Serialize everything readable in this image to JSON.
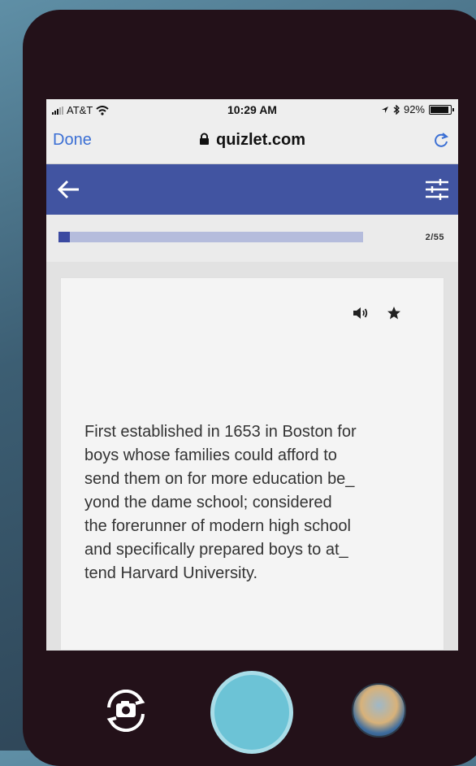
{
  "status_bar": {
    "carrier": "AT&T",
    "time": "10:29 AM",
    "battery": "92%",
    "battery_level": 0.92
  },
  "browser": {
    "done_label": "Done",
    "url": "quizlet.com"
  },
  "progress": {
    "counter": "2/55",
    "current": 2,
    "total": 55
  },
  "card": {
    "text": "First established in 1653 in Boston for\nboys whose families could afford to\nsend them on for more education be_\nyond the dame school; considered\nthe forerunner of modern high school\nand specifically prepared boys to at_\ntend Harvard University."
  },
  "icons": {
    "back": "arrow-left-icon",
    "settings": "sliders-icon",
    "audio": "speaker-icon",
    "star": "star-icon",
    "camera_flip": "camera-flip-icon"
  },
  "colors": {
    "brand": "#4154a1",
    "link": "#3b6fd4",
    "shutter": "#6cc3d6"
  }
}
